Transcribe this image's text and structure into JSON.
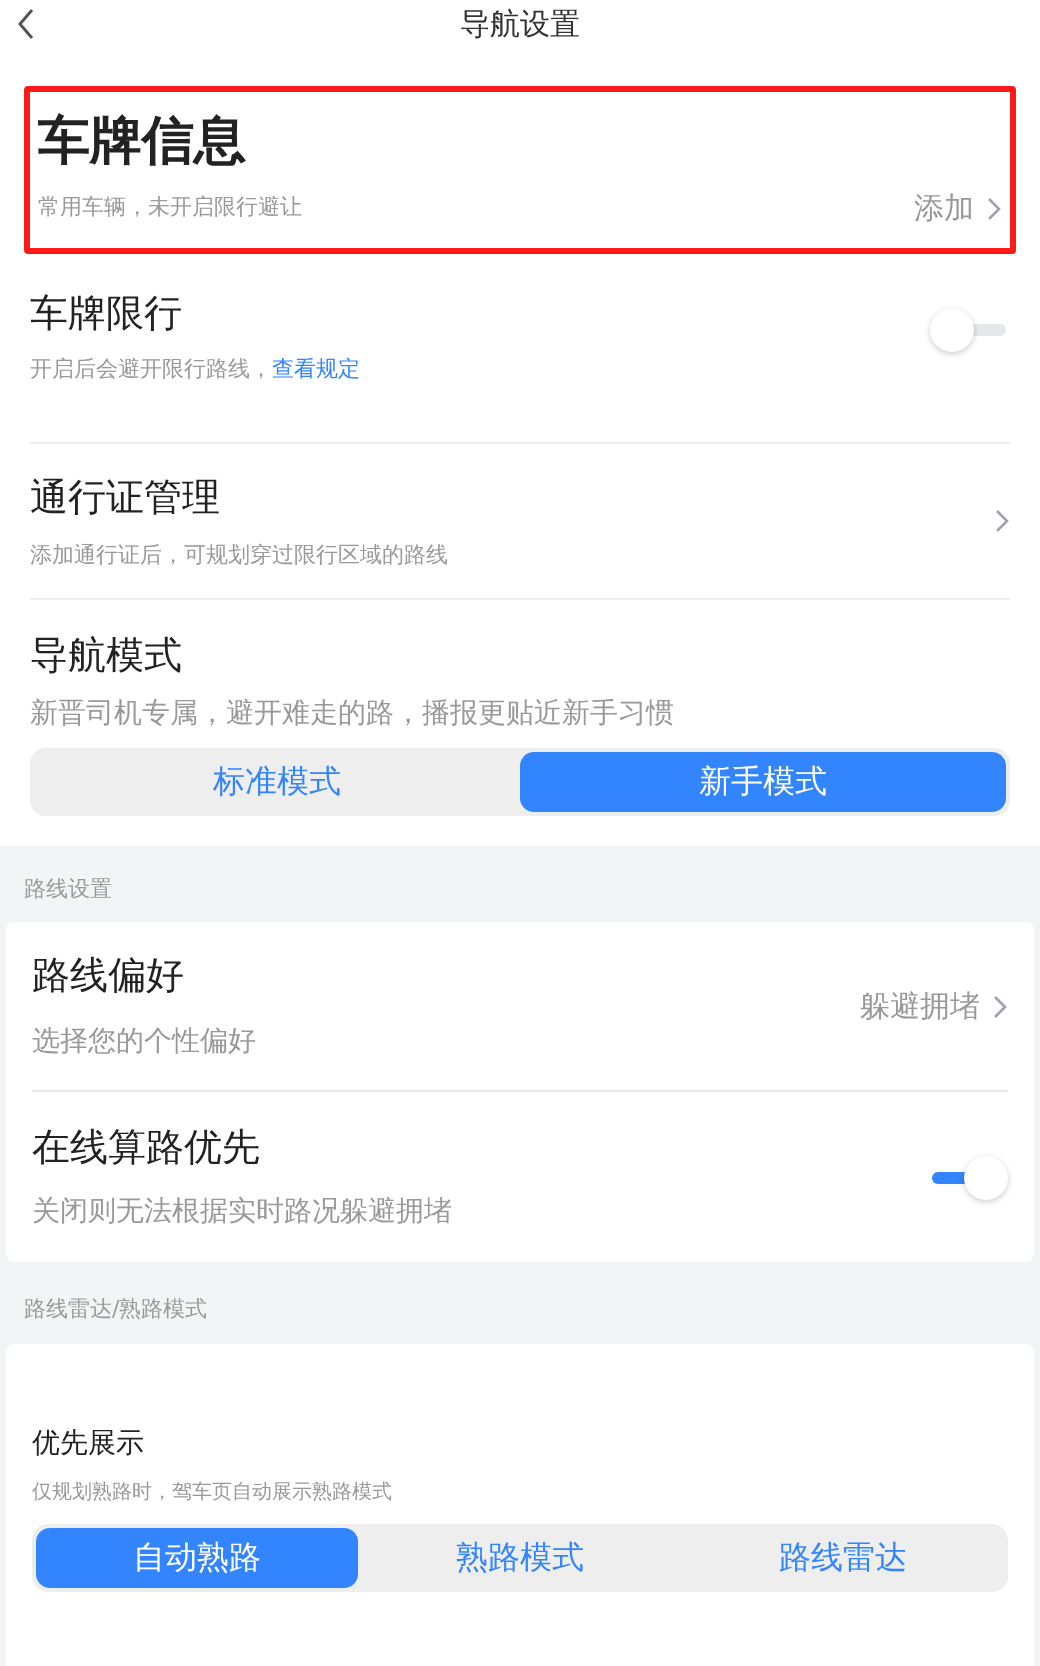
{
  "header": {
    "title": "导航设置"
  },
  "plate_info": {
    "title": "车牌信息",
    "subtitle": "常用车辆，未开启限行避让",
    "action": "添加",
    "highlighted": true
  },
  "plate_restriction": {
    "title": "车牌限行",
    "subtitle": "开启后会避开限行路线，",
    "link": "查看规定",
    "on": false
  },
  "pass_management": {
    "title": "通行证管理",
    "subtitle": "添加通行证后，可规划穿过限行区域的路线"
  },
  "nav_mode": {
    "title": "导航模式",
    "subtitle": "新晋司机专属，避开难走的路，播报更贴近新手习惯",
    "options": [
      {
        "label": "标准模式",
        "selected": false
      },
      {
        "label": "新手模式",
        "selected": true
      }
    ]
  },
  "route_settings": {
    "heading": "路线设置",
    "items": [
      {
        "kind": "link",
        "title": "路线偏好",
        "subtitle": "选择您的个性偏好",
        "value": "躲避拥堵"
      },
      {
        "kind": "toggle",
        "title": "在线算路优先",
        "subtitle": "关闭则无法根据实时路况躲避拥堵",
        "on": true
      }
    ]
  },
  "radar": {
    "heading": "路线雷达/熟路模式",
    "title": "优先展示",
    "subtitle": "仅规划熟路时，驾车页自动展示熟路模式",
    "options": [
      {
        "label": "自动熟路",
        "selected": true
      },
      {
        "label": "熟路模式",
        "selected": false
      },
      {
        "label": "路线雷达",
        "selected": false
      }
    ]
  }
}
